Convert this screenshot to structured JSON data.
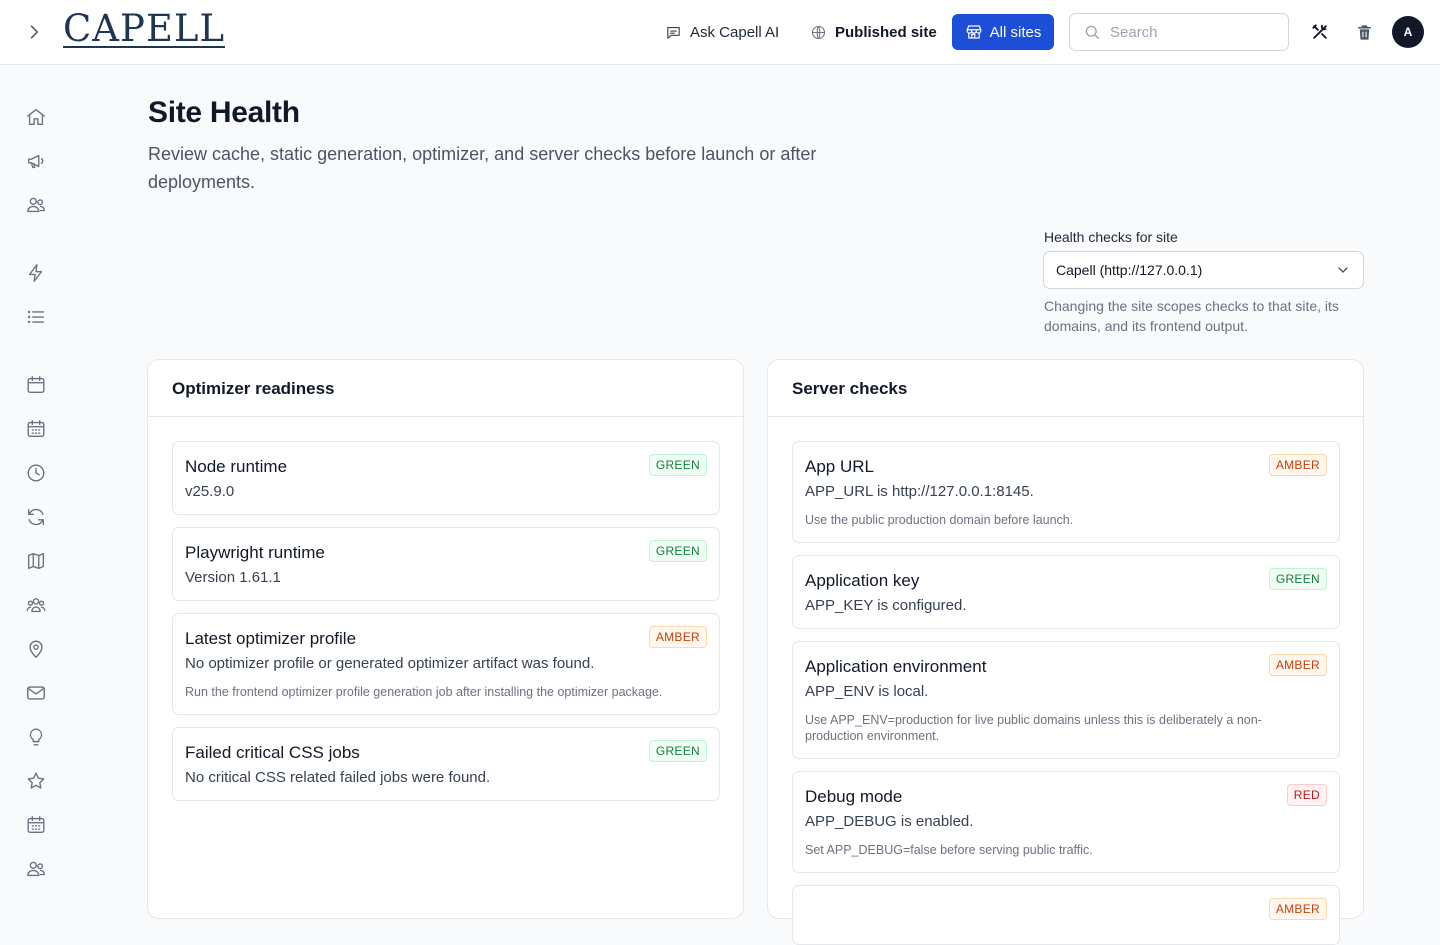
{
  "header": {
    "logo_text": "CAPELL",
    "ask_ai_label": "Ask Capell AI",
    "published_site_label": "Published site",
    "all_sites_label": "All sites",
    "search_placeholder": "Search",
    "avatar_initial": "A"
  },
  "sidebar": {
    "icons": [
      "home-icon",
      "megaphone-icon",
      "users-icon",
      "bolt-icon",
      "list-icon",
      "calendar-icon",
      "calendar-days-icon",
      "clock-icon",
      "refresh-icon",
      "map-icon",
      "user-group-icon",
      "map-pin-icon",
      "envelope-icon",
      "light-bulb-icon",
      "star-icon",
      "calendar-days-icon",
      "users-icon"
    ]
  },
  "page": {
    "title": "Site Health",
    "description": "Review cache, static generation, optimizer, and server checks before launch or after deployments."
  },
  "site_selector": {
    "label": "Health checks for site",
    "selected": "Capell (http://127.0.0.1)",
    "hint": "Changing the site scopes checks to that site, its domains, and its frontend output."
  },
  "optimizer": {
    "title": "Optimizer readiness",
    "items": [
      {
        "title": "Node runtime",
        "value": "v25.9.0",
        "status": "GREEN",
        "hint": ""
      },
      {
        "title": "Playwright runtime",
        "value": "Version 1.61.1",
        "status": "GREEN",
        "hint": ""
      },
      {
        "title": "Latest optimizer profile",
        "value": "No optimizer profile or generated optimizer artifact was found.",
        "status": "AMBER",
        "hint": "Run the frontend optimizer profile generation job after installing the optimizer package."
      },
      {
        "title": "Failed critical CSS jobs",
        "value": "No critical CSS related failed jobs were found.",
        "status": "GREEN",
        "hint": ""
      }
    ]
  },
  "server": {
    "title": "Server checks",
    "items": [
      {
        "title": "App URL",
        "value": "APP_URL is http://127.0.0.1:8145.",
        "status": "AMBER",
        "hint": "Use the public production domain before launch."
      },
      {
        "title": "Application key",
        "value": "APP_KEY is configured.",
        "status": "GREEN",
        "hint": ""
      },
      {
        "title": "Application environment",
        "value": "APP_ENV is local.",
        "status": "AMBER",
        "hint": "Use APP_ENV=production for live public domains unless this is deliberately a non-production environment."
      },
      {
        "title": "Debug mode",
        "value": "APP_DEBUG is enabled.",
        "status": "RED",
        "hint": "Set APP_DEBUG=false before serving public traffic."
      },
      {
        "title": "",
        "value": "",
        "status": "AMBER",
        "hint": ""
      }
    ]
  },
  "colors": {
    "accent": "#1d4ed8",
    "green": "#15803d",
    "amber": "#c2410c",
    "red": "#b91c1c"
  }
}
